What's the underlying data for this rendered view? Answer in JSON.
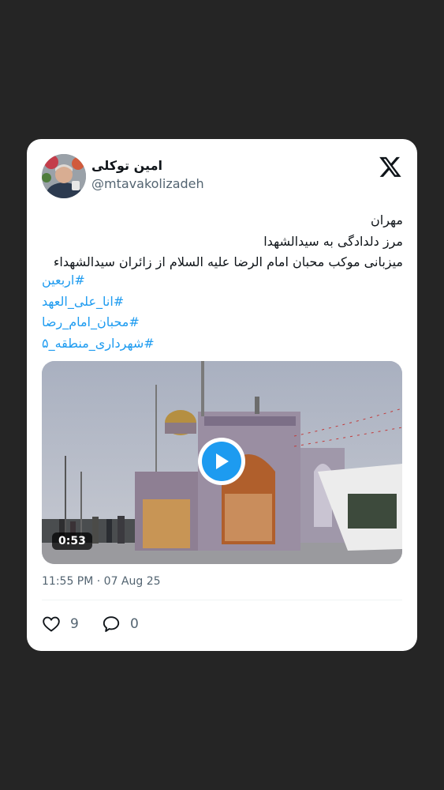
{
  "author": {
    "display_name": "امین توکلی",
    "handle": "@mtavakolizadeh"
  },
  "tweet": {
    "lines": [
      "مهران",
      "مرز دلدادگی به سیدالشهدا",
      "میزبانی موکب محبان امام الرضا علیه السلام از زائران سیدالشهداء"
    ],
    "hashtags": [
      "#اربعین",
      "#انا_علی_العهد",
      "#محبان_امام_رضا",
      "#شهرداری_منطقه_۵"
    ]
  },
  "media": {
    "duration": "0:53",
    "play_icon": "play-icon"
  },
  "timestamp": "11:55 PM · 07 Aug 25",
  "actions": {
    "likes": "9",
    "replies": "0"
  },
  "colors": {
    "background": "#252525",
    "card": "#ffffff",
    "link": "#1d9bf0",
    "muted": "#536471",
    "text": "#0f1419"
  }
}
